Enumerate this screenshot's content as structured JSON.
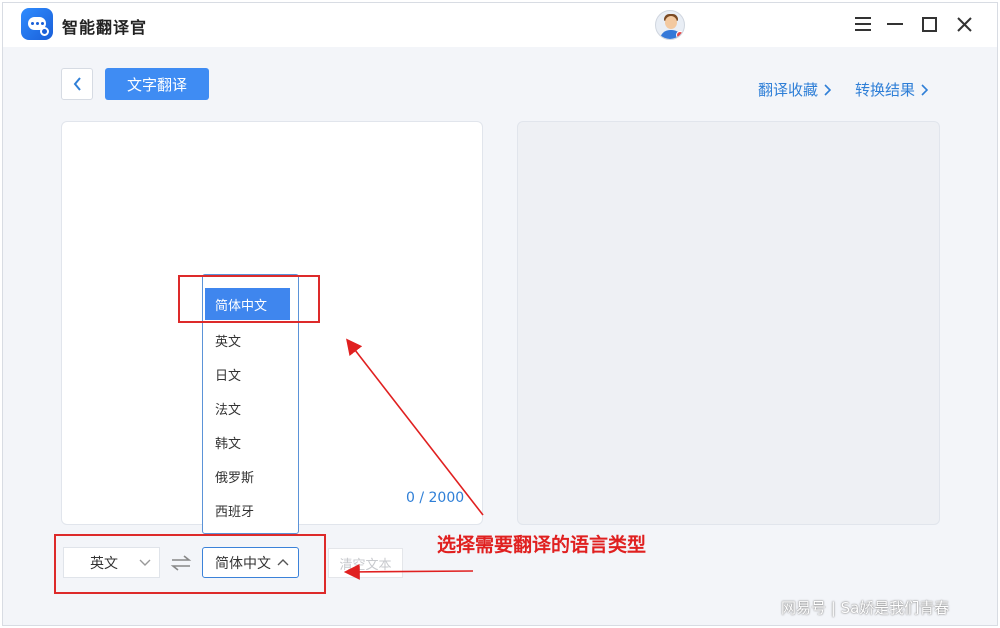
{
  "app": {
    "title": "智能翻译官"
  },
  "toolbar": {
    "mode_label": "文字翻译"
  },
  "links": {
    "favorites": "翻译收藏",
    "results": "转换结果"
  },
  "source": {
    "char_count": "0 / 2000"
  },
  "dropdown": {
    "items": [
      "简体中文",
      "英文",
      "日文",
      "法文",
      "韩文",
      "俄罗斯",
      "西班牙"
    ],
    "selected": "简体中文"
  },
  "controls": {
    "source_lang": "英文",
    "target_lang": "简体中文",
    "clear_label": "清空文本"
  },
  "annotation": {
    "text": "选择需要翻译的语言类型",
    "color": "#e02020"
  },
  "watermark": "网易号 | Sa娇是我们青春",
  "colors": {
    "accent": "#3f8cf3",
    "link": "#2f7fd7"
  }
}
